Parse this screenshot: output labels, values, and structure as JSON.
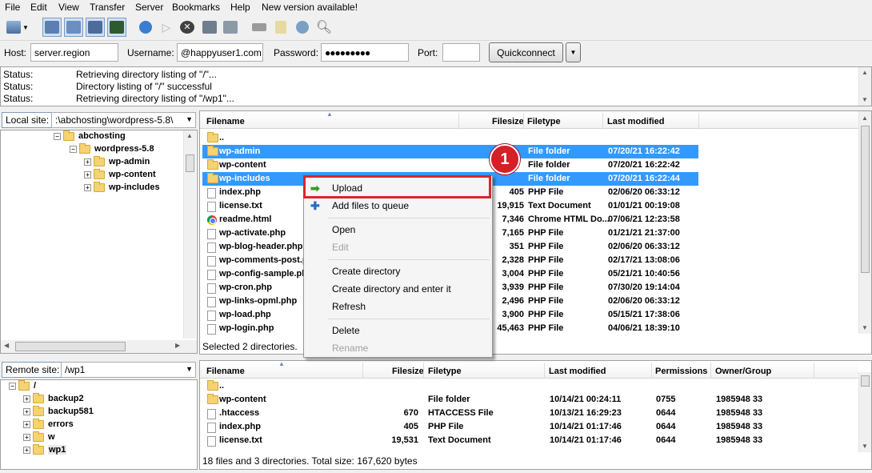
{
  "menu": [
    "File",
    "Edit",
    "View",
    "Transfer",
    "Server",
    "Bookmarks",
    "Help",
    "New version available!"
  ],
  "toolbar_icons": [
    "site-manager-icon",
    "toggle-log-icon",
    "toggle-local-tree-icon",
    "toggle-remote-tree-icon",
    "toggle-queue-icon",
    "refresh-icon",
    "process-queue-icon",
    "cancel-icon",
    "disconnect-icon",
    "reconnect-icon",
    "filter-icon",
    "compare-icon",
    "sync-browse-icon",
    "search-icon"
  ],
  "quickconnect": {
    "host_label": "Host:",
    "host_value": "server.region",
    "user_label": "Username:",
    "user_value": "@happyuser1.com",
    "pass_label": "Password:",
    "pass_value": "●●●●●●●●●",
    "port_label": "Port:",
    "port_value": "",
    "button": "Quickconnect"
  },
  "log": [
    {
      "label": "Status:",
      "msg": "Retrieving directory listing of \"/\"..."
    },
    {
      "label": "Status:",
      "msg": "Directory listing of \"/\" successful"
    },
    {
      "label": "Status:",
      "msg": "Retrieving directory listing of \"/wp1\"..."
    }
  ],
  "local": {
    "site_label": "Local site:",
    "path": ":\\abchosting\\wordpress-5.8\\",
    "tree": [
      "abchosting",
      "wordpress-5.8",
      "wp-admin",
      "wp-content",
      "wp-includes"
    ],
    "columns": [
      "Filename",
      "Filesize",
      "Filetype",
      "Last modified"
    ],
    "files": [
      {
        "name": "..",
        "size": "",
        "type": "",
        "modified": ""
      },
      {
        "name": "wp-admin",
        "size": "",
        "type": "File folder",
        "modified": "07/20/21 16:22:42"
      },
      {
        "name": "wp-content",
        "size": "",
        "type": "File folder",
        "modified": "07/20/21 16:22:42"
      },
      {
        "name": "wp-includes",
        "size": "",
        "type": "File folder",
        "modified": "07/20/21 16:22:44"
      },
      {
        "name": "index.php",
        "size": "405",
        "type": "PHP File",
        "modified": "02/06/20 06:33:12"
      },
      {
        "name": "license.txt",
        "size": "19,915",
        "type": "Text Document",
        "modified": "01/01/21 00:19:08"
      },
      {
        "name": "readme.html",
        "size": "7,346",
        "type": "Chrome HTML Do...",
        "modified": "07/06/21 12:23:58"
      },
      {
        "name": "wp-activate.php",
        "size": "7,165",
        "type": "PHP File",
        "modified": "01/21/21 21:37:00"
      },
      {
        "name": "wp-blog-header.php",
        "size": "351",
        "type": "PHP File",
        "modified": "02/06/20 06:33:12"
      },
      {
        "name": "wp-comments-post.php",
        "size": "2,328",
        "type": "PHP File",
        "modified": "02/17/21 13:08:06"
      },
      {
        "name": "wp-config-sample.php",
        "size": "3,004",
        "type": "PHP File",
        "modified": "05/21/21 10:40:56"
      },
      {
        "name": "wp-cron.php",
        "size": "3,939",
        "type": "PHP File",
        "modified": "07/30/20 19:14:04"
      },
      {
        "name": "wp-links-opml.php",
        "size": "2,496",
        "type": "PHP File",
        "modified": "02/06/20 06:33:12"
      },
      {
        "name": "wp-load.php",
        "size": "3,900",
        "type": "PHP File",
        "modified": "05/15/21 17:38:06"
      },
      {
        "name": "wp-login.php",
        "size": "45,463",
        "type": "PHP File",
        "modified": "04/06/21 18:39:10"
      }
    ],
    "status": "Selected 2 directories."
  },
  "remote": {
    "site_label": "Remote site:",
    "path": "/wp1",
    "tree": [
      "/",
      "backup2",
      "backup581",
      "errors",
      "w",
      "wp1"
    ],
    "columns": [
      "Filename",
      "Filesize",
      "Filetype",
      "Last modified",
      "Permissions",
      "Owner/Group"
    ],
    "files": [
      {
        "name": "..",
        "size": "",
        "type": "",
        "modified": "",
        "perm": "",
        "owner": ""
      },
      {
        "name": "wp-content",
        "size": "",
        "type": "File folder",
        "modified": "10/14/21 00:24:11",
        "perm": "0755",
        "owner": "1985948 33"
      },
      {
        "name": ".htaccess",
        "size": "670",
        "type": "HTACCESS File",
        "modified": "10/13/21 16:29:23",
        "perm": "0644",
        "owner": "1985948 33"
      },
      {
        "name": "index.php",
        "size": "405",
        "type": "PHP File",
        "modified": "10/14/21 01:17:46",
        "perm": "0644",
        "owner": "1985948 33"
      },
      {
        "name": "license.txt",
        "size": "19,531",
        "type": "Text Document",
        "modified": "10/14/21 01:17:46",
        "perm": "0644",
        "owner": "1985948 33"
      }
    ],
    "status": "18 files and 3 directories. Total size: 167,620 bytes"
  },
  "context_menu": {
    "upload": "Upload",
    "add_to_queue": "Add files to queue",
    "open": "Open",
    "edit": "Edit",
    "create_dir": "Create directory",
    "create_dir_enter": "Create directory and enter it",
    "refresh": "Refresh",
    "delete": "Delete",
    "rename": "Rename"
  },
  "step_badge": "1",
  "colors": {
    "selection": "#3399ff",
    "highlight": "#d9262c",
    "badge": "#d61f26"
  }
}
